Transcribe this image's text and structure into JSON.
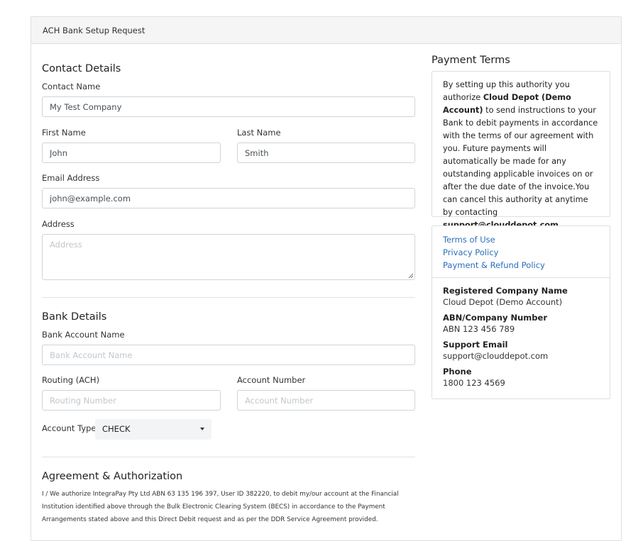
{
  "card": {
    "title": "ACH Bank Setup Request"
  },
  "contact": {
    "heading": "Contact Details",
    "contact_name_label": "Contact Name",
    "contact_name_value": "My Test Company",
    "first_name_label": "First Name",
    "first_name_value": "John",
    "last_name_label": "Last Name",
    "last_name_value": "Smith",
    "email_label": "Email Address",
    "email_value": "john@example.com",
    "address_label": "Address",
    "address_placeholder": "Address"
  },
  "bank": {
    "heading": "Bank Details",
    "account_name_label": "Bank Account Name",
    "account_name_placeholder": "Bank Account Name",
    "routing_label": "Routing (ACH)",
    "routing_placeholder": "Routing Number",
    "account_number_label": "Account Number",
    "account_number_placeholder": "Account Number",
    "account_type_label": "Account Type",
    "account_type_value": "CHECK"
  },
  "agreement": {
    "heading": "Agreement & Authorization",
    "text": "I / We authorize IntegraPay Pty Ltd ABN 63 135 196 397, User ID 382220, to debit my/our account at the Financial Institution identified above through the Bulk Electronic Clearing System (BECS) in accordance to the Payment Arrangements stated above and this Direct Debit request and as per the DDR Service Agreement provided."
  },
  "payment_terms": {
    "heading": "Payment Terms",
    "text_1": "By setting up this authority you authorize ",
    "company": "Cloud Depot (Demo Account)",
    "text_2": " to send instructions to your Bank to debit payments in accordance with the terms of our agreement with you. Future payments will automatically be made for any outstanding applicable invoices on or after the due date of the invoice.You can cancel this authority at anytime by contacting ",
    "support_email": "support@clouddepot.com."
  },
  "links": {
    "terms": "Terms of Use",
    "privacy": "Privacy Policy",
    "refund": "Payment & Refund Policy"
  },
  "company_info": {
    "reg_name_label": "Registered Company Name",
    "reg_name_value": "Cloud Depot (Demo Account)",
    "abn_label": "ABN/Company Number",
    "abn_value": "ABN 123 456 789",
    "support_label": "Support Email",
    "support_value": "support@clouddepot.com",
    "phone_label": "Phone",
    "phone_value": "1800 123 4569"
  }
}
